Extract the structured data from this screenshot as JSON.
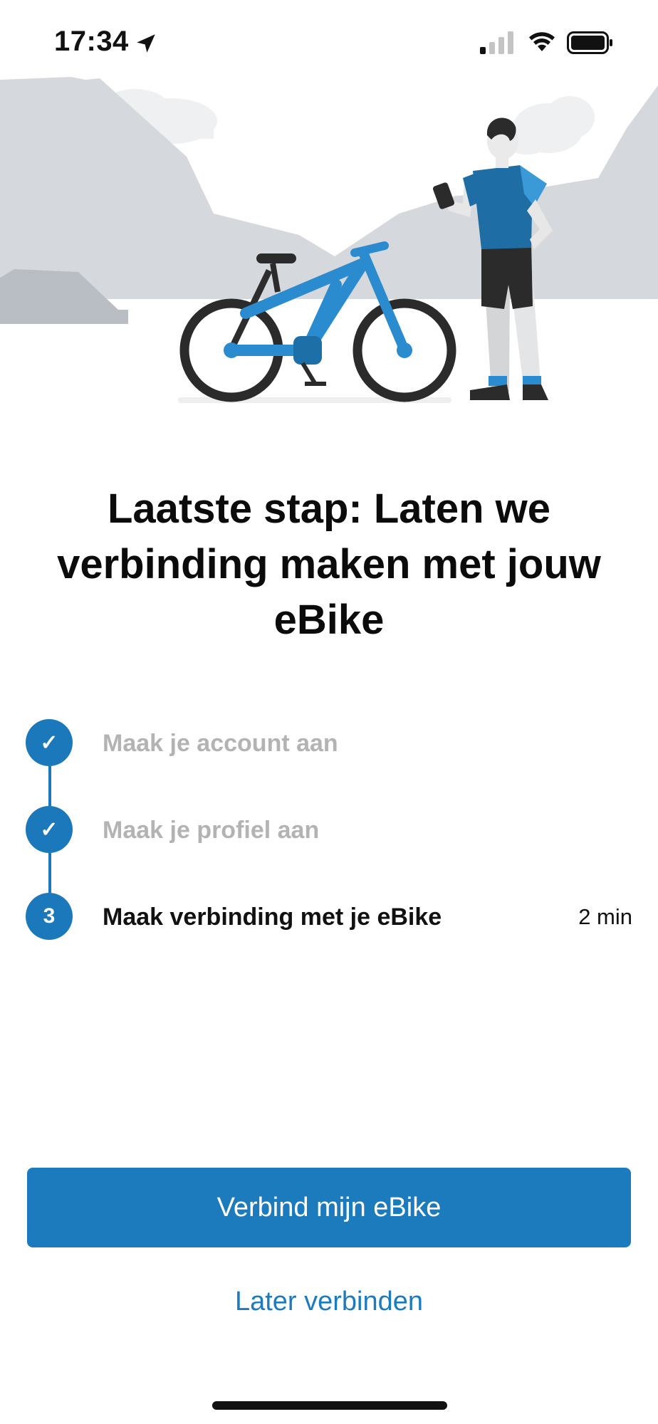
{
  "status_bar": {
    "time": "17:34",
    "icons": [
      "location-arrow-icon",
      "cellular-signal-icon",
      "wifi-icon",
      "battery-icon"
    ]
  },
  "hero": {
    "illustration": "person-with-phone-and-ebike-illustration"
  },
  "headline": "Laatste stap: Laten we verbinding maken met jouw eBike",
  "steps": [
    {
      "marker": "✓",
      "label": "Maak je account aan",
      "state": "done"
    },
    {
      "marker": "✓",
      "label": "Maak je profiel aan",
      "state": "done"
    },
    {
      "marker": "3",
      "label": "Maak verbinding met je eBike",
      "state": "active",
      "duration": "2 min"
    }
  ],
  "actions": {
    "primary_label": "Verbind mijn eBike",
    "secondary_label": "Later verbinden"
  },
  "colors": {
    "accent": "#1b7bbd",
    "done_text": "#b3b3b3",
    "mountain": "#d5d8dc"
  }
}
